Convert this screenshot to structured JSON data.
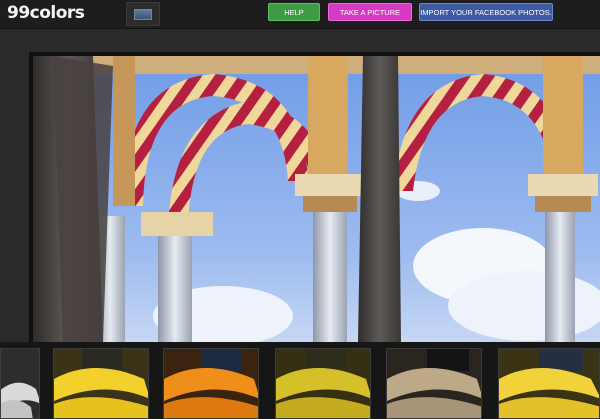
{
  "app": {
    "logo_text": "99colors"
  },
  "toolbar": {
    "help_label": "HELP",
    "take_picture_label": "TAKE A PICTURE",
    "import_facebook_label": "IMPORT YOUR FACEBOOK PHOTOS."
  },
  "colors": {
    "help": "#3f9a45",
    "take_picture": "#d63ac2",
    "import_facebook": "#3e5aa3",
    "topbar": "#1d1d1d",
    "background": "#2a2a2a"
  },
  "filters": [
    {
      "name": "black-and-white",
      "tint": "#d9d9d9"
    },
    {
      "name": "yellow",
      "tint": "#f3d12c"
    },
    {
      "name": "orange",
      "tint": "#ef8f1a"
    },
    {
      "name": "golden",
      "tint": "#d6c02a"
    },
    {
      "name": "sepia",
      "tint": "#bda987"
    },
    {
      "name": "bright-yellow",
      "tint": "#f1d23a"
    }
  ]
}
